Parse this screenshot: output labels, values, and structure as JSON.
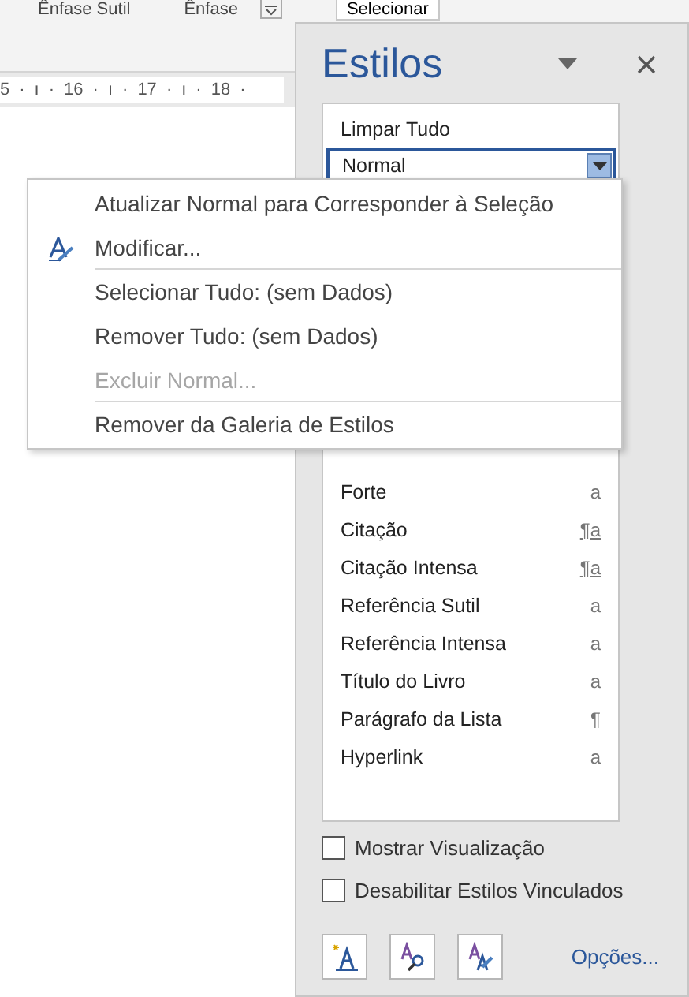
{
  "ribbon": {
    "styles": [
      "Ênfase Sutil",
      "Ênfase"
    ],
    "select_button": "Selecionar"
  },
  "ruler": {
    "ticks": [
      "5",
      "·",
      "ı",
      "·",
      "16",
      "·",
      "ı",
      "·",
      "17",
      "·",
      "ı",
      "·",
      "18",
      "·"
    ]
  },
  "pane": {
    "title": "Estilos",
    "styles": [
      {
        "name": "Limpar Tudo",
        "selected": false
      },
      {
        "name": "Normal",
        "selected": true
      },
      {
        "name": "Forte",
        "symbol": "a",
        "selected": false
      },
      {
        "name": "Citação",
        "symbol": "¶a",
        "selected": false
      },
      {
        "name": "Citação Intensa",
        "symbol": "¶a",
        "selected": false
      },
      {
        "name": "Referência Sutil",
        "symbol": "a",
        "selected": false
      },
      {
        "name": "Referência Intensa",
        "symbol": "a",
        "selected": false
      },
      {
        "name": "Título do Livro",
        "symbol": "a",
        "selected": false
      },
      {
        "name": "Parágrafo da Lista",
        "symbol": "¶",
        "selected": false
      },
      {
        "name": "Hyperlink",
        "symbol": "a",
        "selected": false
      }
    ],
    "options": [
      {
        "label": "Mostrar Visualização",
        "checked": false
      },
      {
        "label": "Desabilitar Estilos Vinculados",
        "checked": false
      }
    ],
    "options_link": "Opções..."
  },
  "context_menu": [
    {
      "label": "Atualizar Normal para Corresponder à Seleção",
      "disabled": false,
      "icon": false,
      "separator_after": false
    },
    {
      "label": "Modificar...",
      "disabled": false,
      "icon": true,
      "separator_after": true
    },
    {
      "label": "Selecionar Tudo: (sem Dados)",
      "disabled": false,
      "icon": false,
      "separator_after": false
    },
    {
      "label": "Remover Tudo: (sem Dados)",
      "disabled": false,
      "icon": false,
      "separator_after": false
    },
    {
      "label": "Excluir Normal...",
      "disabled": true,
      "icon": false,
      "separator_after": true
    },
    {
      "label": "Remover da Galeria de Estilos",
      "disabled": false,
      "icon": false,
      "separator_after": false
    }
  ]
}
